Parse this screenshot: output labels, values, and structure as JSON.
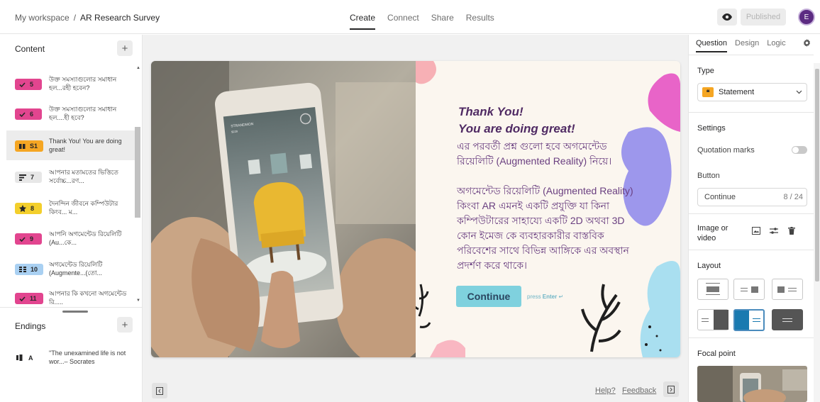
{
  "breadcrumb": {
    "workspace": "My workspace",
    "separator": "/",
    "current": "AR Research Survey"
  },
  "nav_tabs": [
    "Create",
    "Connect",
    "Share",
    "Results"
  ],
  "header": {
    "publish_label": "Published",
    "avatar_initial": "E"
  },
  "left_panel": {
    "content_label": "Content",
    "add_label": "+",
    "items": [
      {
        "number": "5",
        "text": "উক্ত সমস্যাগুলোর সমাধান হল...রহী হবেন?",
        "color": "#e2458f",
        "icon": "check-icon"
      },
      {
        "number": "6",
        "text": "উক্ত সমস্যাগুলোর সমাধান হল....হী হবে?",
        "color": "#e2458f",
        "icon": "check-icon"
      },
      {
        "number": "S1",
        "text": "Thank You! You are doing great!",
        "color": "#f5a623",
        "icon": "quote-icon"
      },
      {
        "number": "7",
        "text": "আপনার মতামতের ভিত্তিতে সর্বোচ্চ...রণ...",
        "color": "#e7e7e7",
        "icon": "ranking-icon"
      },
      {
        "number": "8",
        "text": "দৈনন্দিন জীবনে কম্পিউটার কিংব... ম...",
        "color": "#f3cf2c",
        "icon": "star-icon"
      },
      {
        "number": "9",
        "text": "আপনি অগমেন্টেড রিয়েলিটি (Au...কে...",
        "color": "#e2458f",
        "icon": "check-icon"
      },
      {
        "number": "10",
        "text": "অগমেন্টেড রিয়েলিটি (Augmente...(তো...",
        "color": "#a9d0f2",
        "icon": "matrix-icon"
      },
      {
        "number": "11",
        "text": "আপনার কি কখনো অগমেন্টেড রি.....",
        "color": "#e2458f",
        "icon": "check-icon"
      }
    ],
    "endings_label": "Endings",
    "ending": {
      "letter": "A",
      "text": "\"The unexamined life is not wor...– Socrates"
    }
  },
  "canvas": {
    "heading_line1": "Thank You!",
    "heading_line2": "You are doing great!",
    "paragraph1": "এর পরবর্তী প্রশ্ন গুলো হবে অগমেন্টেড রিয়েলিটি (Augmented Reality) নিয়ে।",
    "paragraph2": "অগমেন্টেড রিয়েলিটি (Augmented Reality) কিংবা AR এমনই একটি প্রযুক্তি যা কিনা কম্পিউটারের সাহায্যে একটি 2D অথবা 3D কোন ইমেজ কে ব্যবহারকারীর বাস্তবিক পরিবেশের সাথে বিভিন্ন আঙ্গিকে এর অবস্থান প্রদর্শণ করে থাকে।",
    "button_label": "Continue",
    "press_prefix": "press",
    "press_key": "Enter",
    "press_symbol": "↵",
    "phone_brand": "STRANDMON",
    "phone_price": "$229",
    "help_label": "Help?",
    "feedback_label": "Feedback",
    "accent_color": "#7fd1de",
    "text_color": "#4f2a63"
  },
  "right_panel": {
    "tabs": [
      "Question",
      "Design",
      "Logic"
    ],
    "type_label": "Type",
    "type_value": "Statement",
    "type_icon_glyph": "❝",
    "settings_label": "Settings",
    "quotation_label": "Quotation marks",
    "quotation_enabled": false,
    "button_label": "Button",
    "button_value": "Continue",
    "button_count": "8 / 24",
    "media_label": "Image or video",
    "layout_label": "Layout",
    "selected_layout": 5,
    "focal_label": "Focal point"
  }
}
